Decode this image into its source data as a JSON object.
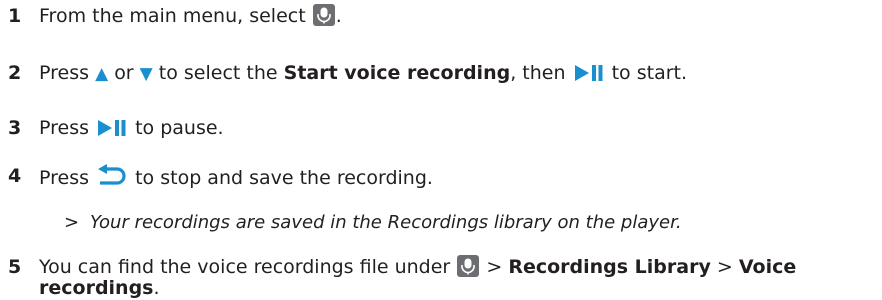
{
  "steps": [
    {
      "number": "1",
      "text_before": "From the main menu, select",
      "text_after": "."
    },
    {
      "number": "2",
      "press": "Press",
      "up_symbol": "▲",
      "or": "or",
      "down_symbol": "▼",
      "to_select": "to select the",
      "bold": "Start voice recording",
      "then": ", then",
      "to_start": "to start."
    },
    {
      "number": "3",
      "press": "Press",
      "to_pause": "to pause."
    },
    {
      "number": "4",
      "press": "Press",
      "rest": "to stop and save the recording."
    },
    {
      "number": "5",
      "text_before": "You can find the voice recordings file under",
      "sep1": ">",
      "bold1": "Recordings Library",
      "sep2": ">",
      "bold2a": "Voice",
      "bold2b": "recordings",
      "end": "."
    }
  ],
  "result": {
    "marker": ">",
    "text": "Your recordings are saved in the Recordings library on the player."
  },
  "colors": {
    "text": "#231f20",
    "accent": "#1a8fd0",
    "mic_bg": "#6d6e71"
  },
  "icons": [
    "mic-icon",
    "up-arrow-icon",
    "down-arrow-icon",
    "play-pause-icon",
    "back-icon"
  ]
}
